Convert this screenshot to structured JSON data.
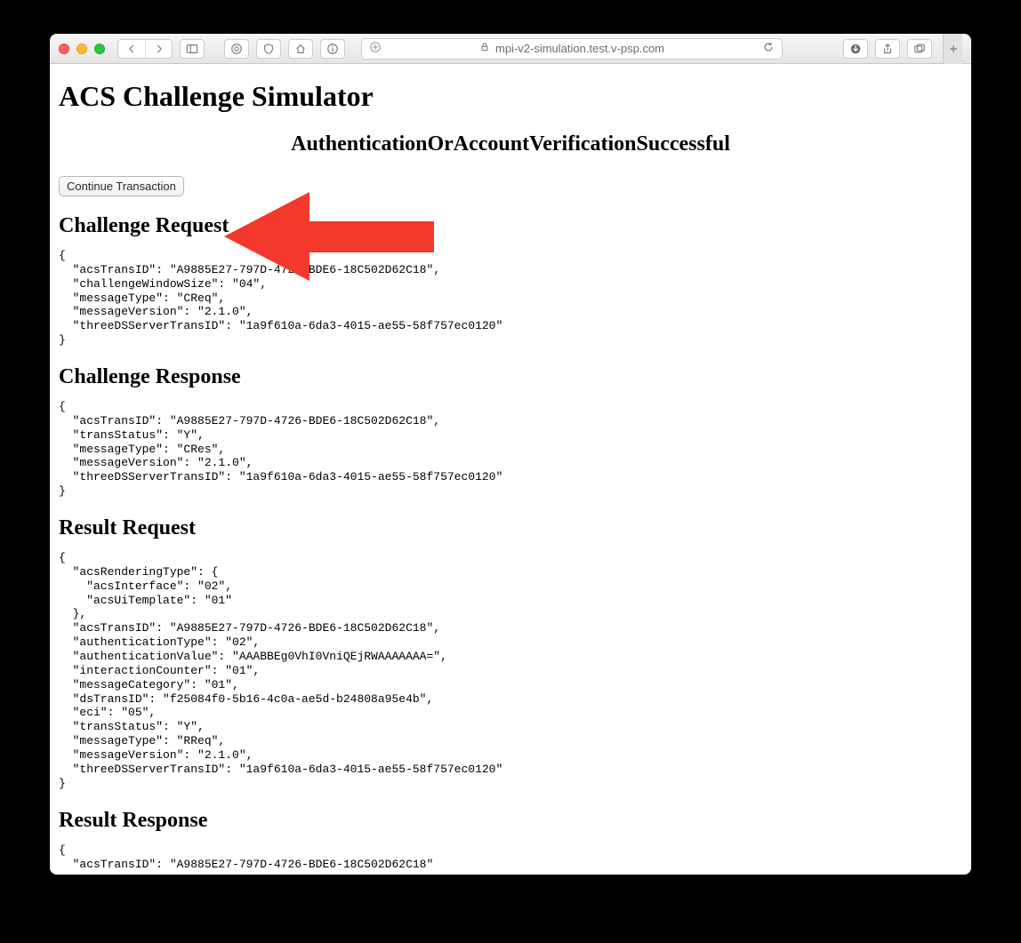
{
  "browser": {
    "url": "mpi-v2-simulation.test.v-psp.com"
  },
  "page": {
    "title": "ACS Challenge Simulator",
    "status_heading": "AuthenticationOrAccountVerificationSuccessful",
    "continue_button_label": "Continue Transaction",
    "sections": {
      "challenge_request": {
        "heading": "Challenge Request",
        "body": "{\n  \"acsTransID\": \"A9885E27-797D-4726-BDE6-18C502D62C18\",\n  \"challengeWindowSize\": \"04\",\n  \"messageType\": \"CReq\",\n  \"messageVersion\": \"2.1.0\",\n  \"threeDSServerTransID\": \"1a9f610a-6da3-4015-ae55-58f757ec0120\"\n}"
      },
      "challenge_response": {
        "heading": "Challenge Response",
        "body": "{\n  \"acsTransID\": \"A9885E27-797D-4726-BDE6-18C502D62C18\",\n  \"transStatus\": \"Y\",\n  \"messageType\": \"CRes\",\n  \"messageVersion\": \"2.1.0\",\n  \"threeDSServerTransID\": \"1a9f610a-6da3-4015-ae55-58f757ec0120\"\n}"
      },
      "result_request": {
        "heading": "Result Request",
        "body": "{\n  \"acsRenderingType\": {\n    \"acsInterface\": \"02\",\n    \"acsUiTemplate\": \"01\"\n  },\n  \"acsTransID\": \"A9885E27-797D-4726-BDE6-18C502D62C18\",\n  \"authenticationType\": \"02\",\n  \"authenticationValue\": \"AAABBEg0VhI0VniQEjRWAAAAAAA=\",\n  \"interactionCounter\": \"01\",\n  \"messageCategory\": \"01\",\n  \"dsTransID\": \"f25084f0-5b16-4c0a-ae5d-b24808a95e4b\",\n  \"eci\": \"05\",\n  \"transStatus\": \"Y\",\n  \"messageType\": \"RReq\",\n  \"messageVersion\": \"2.1.0\",\n  \"threeDSServerTransID\": \"1a9f610a-6da3-4015-ae55-58f757ec0120\"\n}"
      },
      "result_response": {
        "heading": "Result Response",
        "body": "{\n  \"acsTransID\": \"A9885E27-797D-4726-BDE6-18C502D62C18\""
      }
    }
  }
}
